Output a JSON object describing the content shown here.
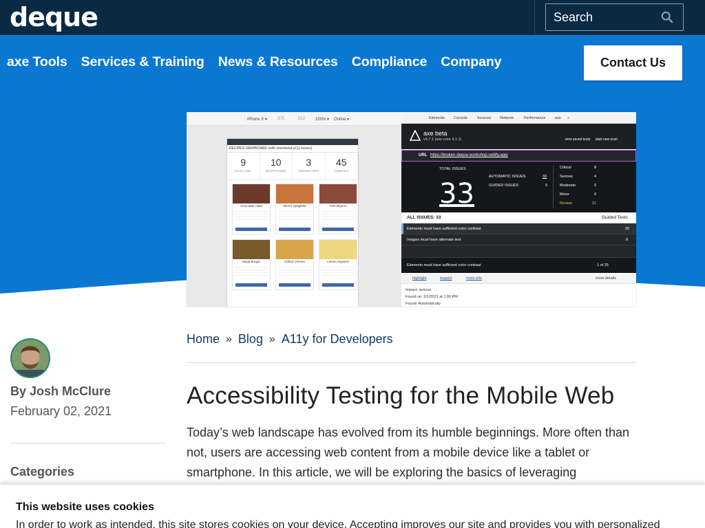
{
  "header": {
    "logo_text": "deque",
    "search": {
      "placeholder": "Search",
      "icon": "search-icon"
    }
  },
  "nav": {
    "items": [
      "axe Tools",
      "Services & Training",
      "News & Resources",
      "Compliance",
      "Company"
    ],
    "contact_label": "Contact Us"
  },
  "hero": {
    "devtools_device": "iPhone X ▾",
    "devtools_width": "375",
    "devtools_height": "812",
    "devtools_zoom": "100% ▾",
    "devtools_network": "Online ▾",
    "app_title": "RECIPES DASHBOARD (with intentional a11y issues)",
    "stats": [
      {
        "value": "9",
        "label": "EGGS USED"
      },
      {
        "value": "10",
        "label": "RECIPES MADE"
      },
      {
        "value": "3",
        "label": "GREASE FIRES"
      },
      {
        "value": "45",
        "label": "YUMM RES"
      }
    ],
    "recipes": [
      "Chocolate Cake",
      "Mom's Spaghetti",
      "Filet Mignon",
      "Mega Burger",
      "Grilled Cheese",
      "Lemon Squares"
    ],
    "devtools_tabs": [
      "Elements",
      "Console",
      "Sources",
      "Network",
      "Performance",
      "axe",
      "»"
    ],
    "axe_name": "axe beta",
    "axe_version": "v4.7.1 (axe-core 4.1.1)",
    "view_saved_label": "view saved tests",
    "start_scan_label": "start new scan",
    "url_label": "URL",
    "url_value": "https://broken-deque-workshop.netlify.app/",
    "total_issues_label": "TOTAL ISSUES",
    "total_issues": "33",
    "automatic_label": "AUTOMATIC ISSUES",
    "automatic_count": "33",
    "guided_label": "GUIDED ISSUES",
    "guided_count": "0",
    "severity": [
      {
        "label": "Critical",
        "count": "8"
      },
      {
        "label": "Serious",
        "count": "4"
      },
      {
        "label": "Moderate",
        "count": "0"
      },
      {
        "label": "Minor",
        "count": "0"
      },
      {
        "label": "Review",
        "count": "21"
      }
    ],
    "all_issues_label": "ALL ISSUES: 33",
    "guided_tests_label": "Guided Tests",
    "issues": [
      {
        "text": "Elements must have sufficient color contrast",
        "count": "25"
      },
      {
        "text": "Images must have alternate text",
        "count": "8"
      }
    ],
    "selected_issue": "Elements must have sufficient color contrast",
    "pager": "1 of 25",
    "detail_links": [
      "highlight",
      "inspect",
      "more info"
    ],
    "more_details": "more details",
    "impact": "Impact: serious",
    "found_on": "Found on: 2/1/2021 at 1:00 PM",
    "found": "Found: Automatically"
  },
  "breadcrumb": [
    "Home",
    "Blog",
    "A11y for Developers"
  ],
  "breadcrumb_separator": "»",
  "article": {
    "title": "Accessibility Testing for the Mobile Web",
    "intro": "Today’s web landscape has evolved from its humble beginnings. More often than not, users are accessing web content from a mobile device like a tablet or smartphone. In this article, we will be exploring the basics of leveraging"
  },
  "sidebar": {
    "author": "By Josh McClure",
    "date": "February 02, 2021",
    "categories_label": "Categories"
  },
  "cookie": {
    "title": "This website uses cookies",
    "text": "In order to work as intended, this site stores cookies on your device. Accepting improves our site and provides you with personalized"
  },
  "colors": {
    "topbar": "#0a2a43",
    "brand_blue": "#0a78d2",
    "link": "#0f3a5f"
  }
}
